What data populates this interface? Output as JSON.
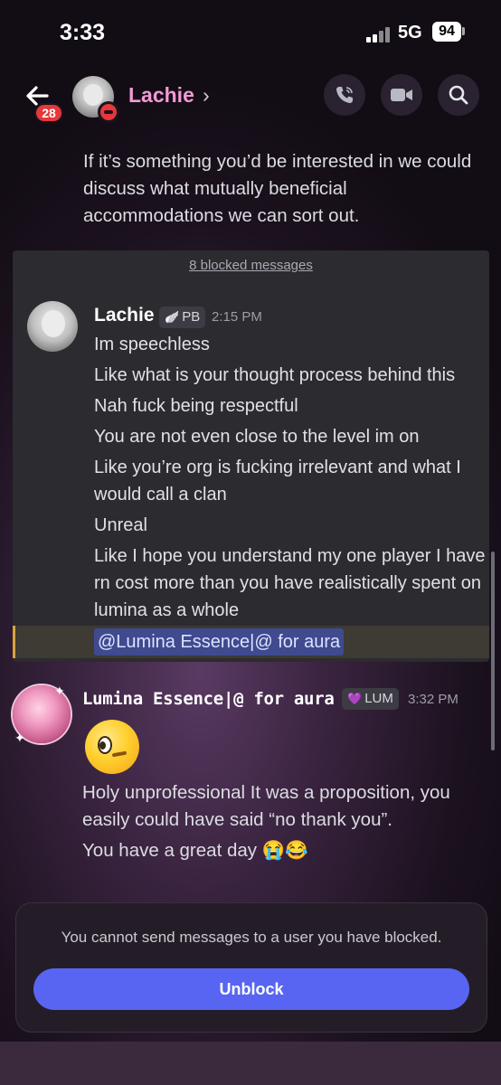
{
  "status_bar": {
    "time": "3:33",
    "network": "5G",
    "battery": "94"
  },
  "header": {
    "back_badge": "28",
    "title": "Lachie",
    "chevron": "›",
    "actions": [
      "phone-icon",
      "video-icon",
      "search-icon"
    ]
  },
  "top_message": {
    "text": "If it’s something you’d be interested in we could discuss what mutually beneficial accommodations we can sort out."
  },
  "blocked_group": {
    "link": "8 blocked messages",
    "author": "Lachie",
    "tag": "PB",
    "tag_emoji": "🪽",
    "time": "2:15 PM",
    "lines": [
      "Im speechless",
      "Like what is your thought process behind this",
      "Nah fuck being respectful",
      "You are not even close to the level im on",
      "Like you’re org is fucking irrelevant and what I would call a clan",
      "Unreal",
      "Like I hope you understand my one player I have rn cost more than you have realistically spent on lumina as a whole"
    ],
    "mention": "@Lumina Essence|@ for aura"
  },
  "lumina_message": {
    "author": "Lumina Essence|@ for aura",
    "tag": "LUM",
    "tag_emoji": "💜",
    "time": "3:32 PM",
    "lines": [
      "Holy unprofessional It was a proposition, you easily could have said “no thank you”.",
      "You have a great day 😭😂"
    ]
  },
  "blocked_notice": {
    "text": "You cannot send messages to a user you have blocked.",
    "button": "Unblock"
  },
  "colors": {
    "accent": "#5865f2",
    "username_pink": "#f39ad6",
    "badge_red": "#e5383b",
    "mention_bg": "#3f4a8f"
  }
}
